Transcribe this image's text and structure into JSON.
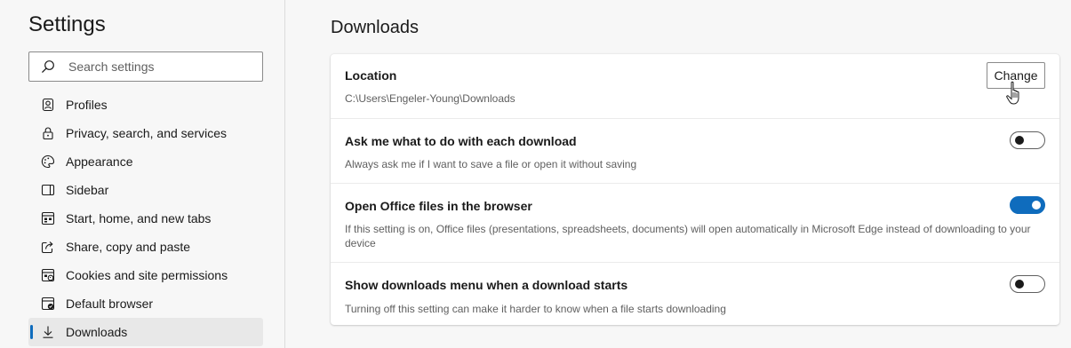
{
  "sidebar": {
    "title": "Settings",
    "search": {
      "placeholder": "Search settings",
      "value": ""
    },
    "items": [
      {
        "label": "Profiles",
        "icon": "profile-icon"
      },
      {
        "label": "Privacy, search, and services",
        "icon": "lock-icon"
      },
      {
        "label": "Appearance",
        "icon": "appearance-icon"
      },
      {
        "label": "Sidebar",
        "icon": "sidebar-icon"
      },
      {
        "label": "Start, home, and new tabs",
        "icon": "home-tabs-icon"
      },
      {
        "label": "Share, copy and paste",
        "icon": "share-icon"
      },
      {
        "label": "Cookies and site permissions",
        "icon": "cookies-icon"
      },
      {
        "label": "Default browser",
        "icon": "default-browser-icon"
      },
      {
        "label": "Downloads",
        "icon": "download-icon",
        "selected": true
      }
    ]
  },
  "main": {
    "title": "Downloads",
    "location": {
      "title": "Location",
      "path": "C:\\Users\\Engeler-Young\\Downloads",
      "button": "Change"
    },
    "ask": {
      "title": "Ask me what to do with each download",
      "desc": "Always ask me if I want to save a file or open it without saving",
      "enabled": false
    },
    "office": {
      "title": "Open Office files in the browser",
      "desc": "If this setting is on, Office files (presentations, spreadsheets, documents) will open automatically in Microsoft Edge instead of downloading to your device",
      "enabled": true
    },
    "menu": {
      "title": "Show downloads menu when a download starts",
      "desc": "Turning off this setting can make it harder to know when a file starts downloading",
      "enabled": false
    }
  },
  "colors": {
    "accent": "#0f6cbd",
    "background": "#f7f7f7",
    "card": "#ffffff"
  }
}
